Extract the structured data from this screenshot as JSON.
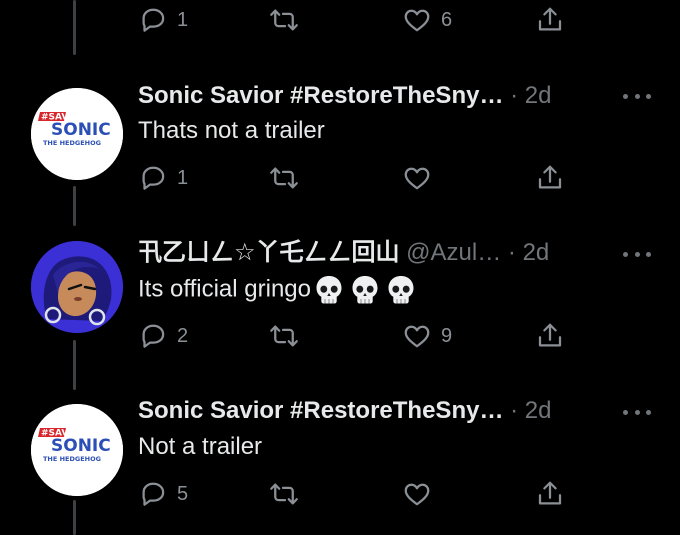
{
  "top_actions": {
    "reply_count": "1",
    "retweet_count": "",
    "like_count": "6"
  },
  "tweets": [
    {
      "name": "Sonic Savior #RestoreTheSny…",
      "meta": " · 2d",
      "avatar_text": {
        "line1": "#SAVE",
        "line2": "SONIC",
        "line3": "THE HEDGEHOG"
      },
      "text": "Thats not a trailer",
      "reply_count": "1",
      "retweet_count": "",
      "like_count": ""
    },
    {
      "name": "卂乙ㄩㄥ☆丫乇ㄥㄥ回山",
      "meta": " @Azul… · 2d",
      "text": "Its official gringo",
      "emoji": "skull",
      "reply_count": "2",
      "retweet_count": "",
      "like_count": "9"
    },
    {
      "name": "Sonic Savior #RestoreTheSny…",
      "meta": " · 2d",
      "avatar_text": {
        "line1": "#SAVE",
        "line2": "SONIC",
        "line3": "THE HEDGEHOG"
      },
      "text": "Not a trailer",
      "reply_count": "5",
      "retweet_count": "",
      "like_count": ""
    }
  ],
  "colors": {
    "background": "#000000",
    "text": "#e7e9ea",
    "muted": "#71767b",
    "sonic_blue": "#2c4fb5",
    "save_red": "#d8262c"
  }
}
